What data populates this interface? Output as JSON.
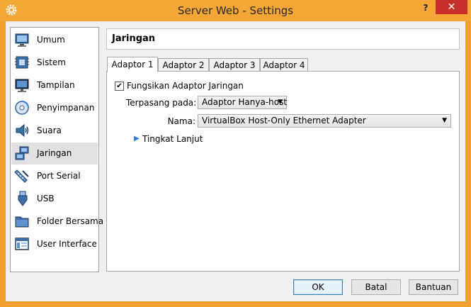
{
  "window": {
    "title": "Server Web - Settings",
    "help": "?",
    "close": "✕"
  },
  "sidebar": {
    "items": [
      {
        "label": "Umum",
        "icon": "monitor-general-icon"
      },
      {
        "label": "Sistem",
        "icon": "motherboard-icon"
      },
      {
        "label": "Tampilan",
        "icon": "display-icon"
      },
      {
        "label": "Penyimpanan",
        "icon": "storage-disk-icon"
      },
      {
        "label": "Suara",
        "icon": "speaker-icon"
      },
      {
        "label": "Jaringan",
        "icon": "network-icon",
        "active": true
      },
      {
        "label": "Port Serial",
        "icon": "serial-port-icon"
      },
      {
        "label": "USB",
        "icon": "usb-icon"
      },
      {
        "label": "Folder Bersama",
        "icon": "shared-folder-icon"
      },
      {
        "label": "User Interface",
        "icon": "user-interface-icon"
      }
    ]
  },
  "page": {
    "title": "Jaringan"
  },
  "tabs": [
    {
      "label": "Adaptor 1",
      "active": true
    },
    {
      "label": "Adaptor 2"
    },
    {
      "label": "Adaptor 3"
    },
    {
      "label": "Adaptor 4"
    }
  ],
  "adapter": {
    "enable_label": "Fungsikan Adaptor Jaringan",
    "enabled": true,
    "check_mark": "✔",
    "attached_label": "Terpasang pada:",
    "attached_value": "Adaptor Hanya-host",
    "name_label": "Nama:",
    "name_value": "VirtualBox Host-Only Ethernet Adapter",
    "advanced_label": "Tingkat Lanjut",
    "dropdown_arrow": "▼",
    "expander_arrow": "▶"
  },
  "buttons": {
    "ok": "OK",
    "cancel": "Batal",
    "help": "Bantuan"
  },
  "colors": {
    "titlebar": "#f4a637",
    "close": "#c7302a",
    "selected_item": "#e1e1e1",
    "accent": "#2a7ed8"
  }
}
